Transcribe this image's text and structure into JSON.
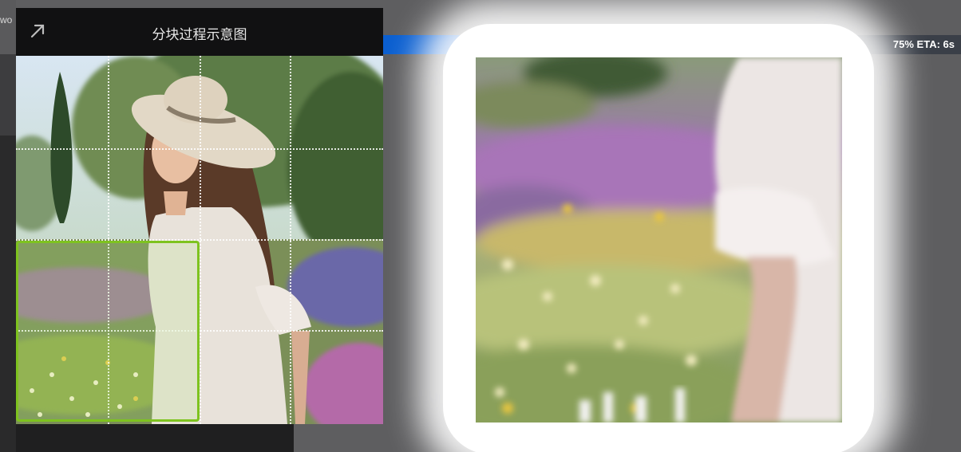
{
  "background": {
    "left_fragment_text": "wo"
  },
  "progress": {
    "percent": 75,
    "label": "75% ETA: 6s",
    "fill_color": "#0b5fd0"
  },
  "diagram": {
    "title": "分块过程示意图",
    "expand_icon": "arrow-up-right-icon",
    "grid_columns": 4,
    "grid_rows": 4,
    "highlighted_tile": {
      "column": 1,
      "row": 3
    },
    "highlight_color": "#7ec31f"
  },
  "output_preview": {
    "glow_color": "#ffffff"
  }
}
